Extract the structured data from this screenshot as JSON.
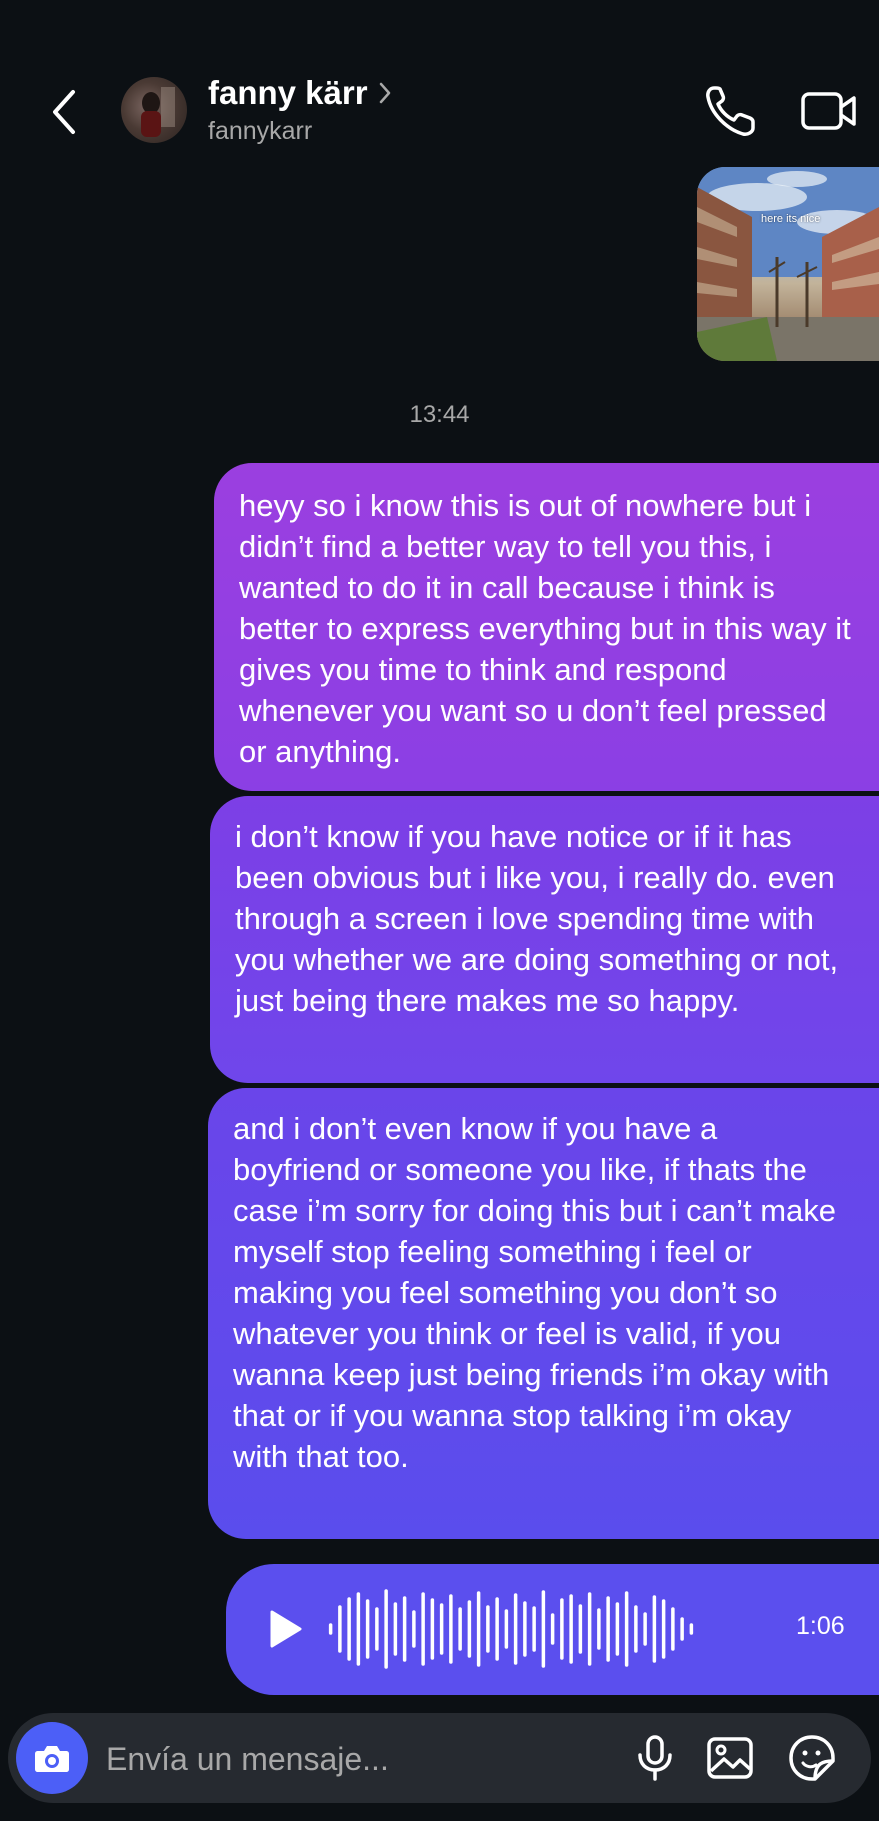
{
  "header": {
    "name": "fanny kärr",
    "username": "fannykarr",
    "back_icon": "chevron-left-icon",
    "call_icon": "phone-icon",
    "video_icon": "video-camera-icon"
  },
  "messages": {
    "photo_caption": "here its nice",
    "timestamp": "13:44",
    "bubble_1": "heyy so i know this is out of nowhere but i didn’t find a better way to tell you this, i wanted to do it in call because i think is better to express everything but in this way it gives you time to think and respond whenever you want so u don’t feel pressed or anything.",
    "bubble_2": "i don’t know if you have notice or if it has been obvious but i like you, i really do. even through a screen i love spending time with you whether we are doing something or not, just being there makes me so happy.",
    "bubble_3": "and i don’t even know if you have a boyfriend or someone you like, if thats the case i’m sorry for doing this but i can’t make myself stop feeling something i feel or making you feel something you don’t so whatever you think or feel is valid, if you wanna keep just being friends i’m okay with that or if you wanna stop talking i’m okay with that too.",
    "voice_duration": "1:06"
  },
  "composer": {
    "placeholder": "Envía un mensaje...",
    "camera_icon": "camera-icon",
    "mic_icon": "microphone-icon",
    "gallery_icon": "image-icon",
    "sticker_icon": "sticker-icon"
  },
  "colors": {
    "background": "#0c1014",
    "bubble_top": "#9b3fe0",
    "bubble_bottom": "#5a4ded",
    "camera_button": "#4c5ff7",
    "secondary_text": "#a8a8a8"
  }
}
